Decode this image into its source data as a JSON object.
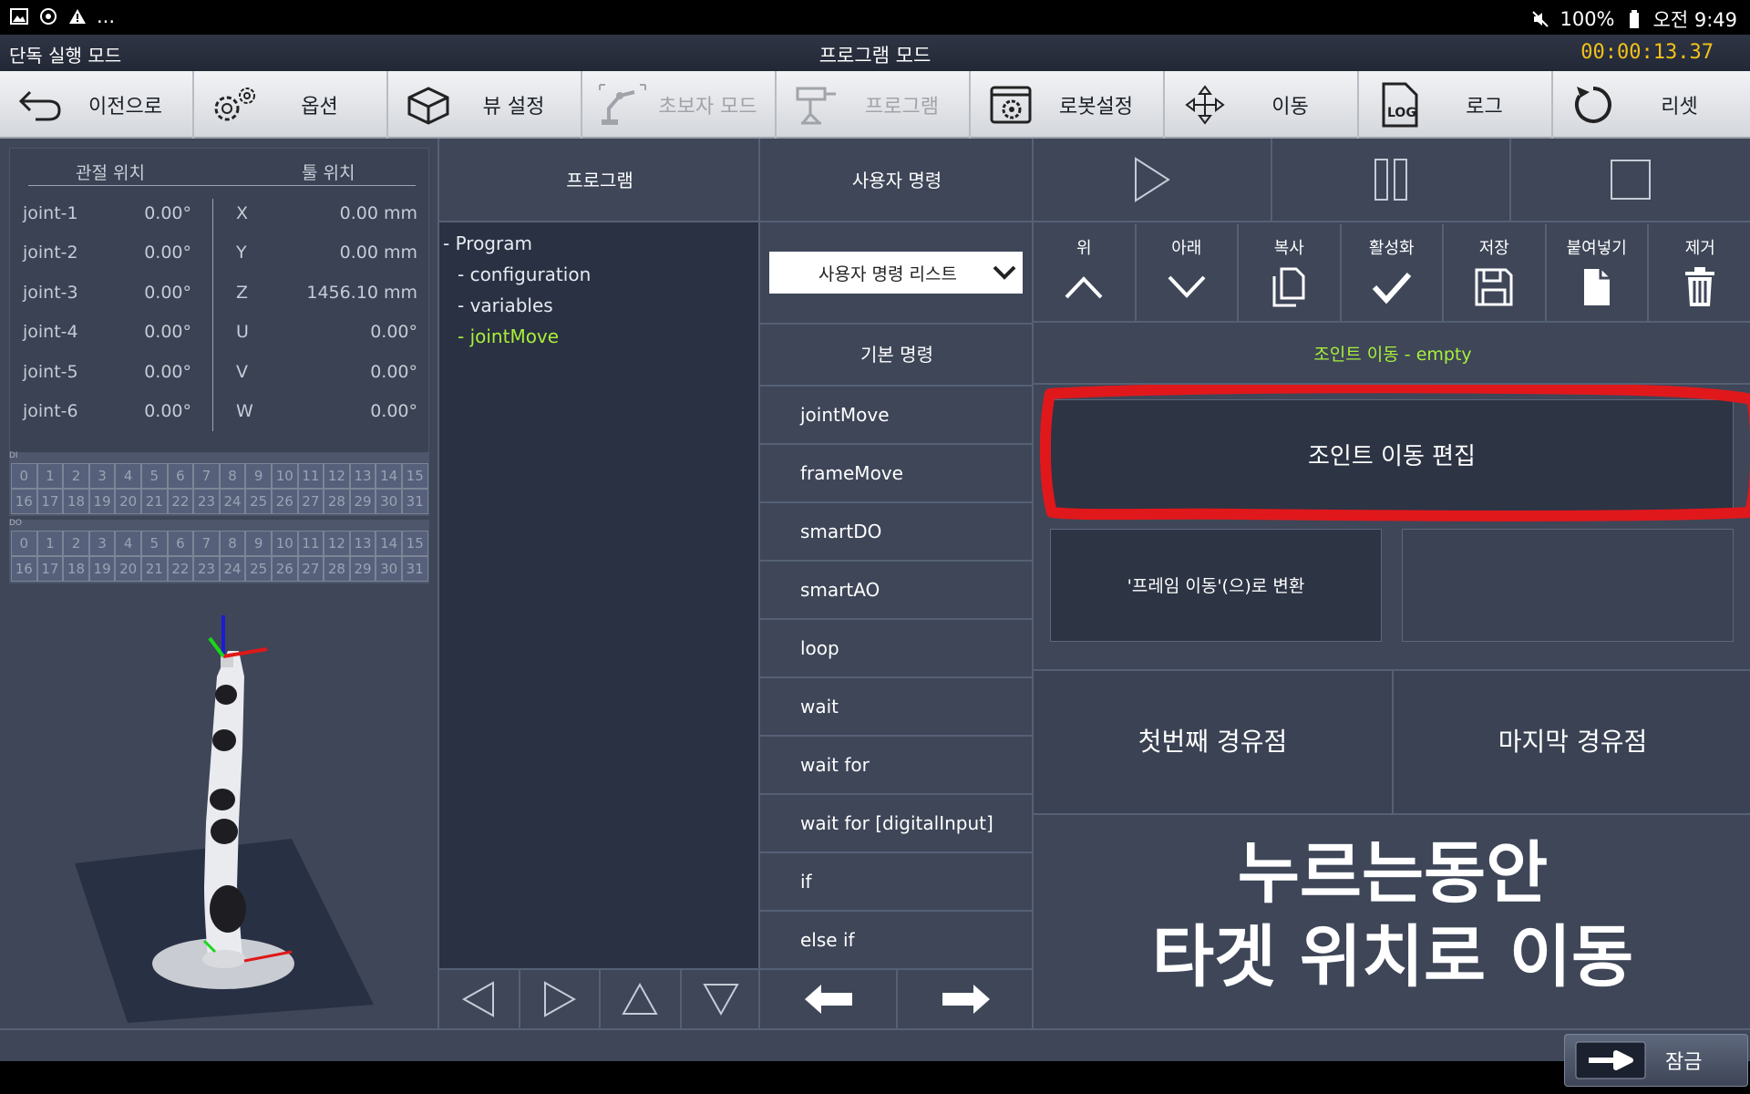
{
  "status_bar": {
    "left_icons": [
      "image-icon",
      "sync-icon",
      "warning-icon"
    ],
    "left_more": "...",
    "battery": "100%",
    "time": "오전 9:49"
  },
  "mode_bar": {
    "left": "단독 실행 모드",
    "center": "프로그램 모드",
    "timer": "00:00:13.37"
  },
  "toolbar": {
    "back": "이전으로",
    "options": "옵션",
    "view": "뷰 설정",
    "beginner": "초보자 모드",
    "program": "프로그램",
    "robot_settings": "로봇설정",
    "move": "이동",
    "log": "로그",
    "reset": "리셋"
  },
  "position": {
    "joint_header": "관절 위치",
    "tool_header": "툴 위치",
    "rows": [
      {
        "joint": "joint-1",
        "jval": "0.00°",
        "axis": "X",
        "tval": "0.00 mm"
      },
      {
        "joint": "joint-2",
        "jval": "0.00°",
        "axis": "Y",
        "tval": "0.00 mm"
      },
      {
        "joint": "joint-3",
        "jval": "0.00°",
        "axis": "Z",
        "tval": "1456.10 mm"
      },
      {
        "joint": "joint-4",
        "jval": "0.00°",
        "axis": "U",
        "tval": "0.00°"
      },
      {
        "joint": "joint-5",
        "jval": "0.00°",
        "axis": "V",
        "tval": "0.00°"
      },
      {
        "joint": "joint-6",
        "jval": "0.00°",
        "axis": "W",
        "tval": "0.00°"
      }
    ]
  },
  "io": {
    "di_label": "DI",
    "do_label": "DO",
    "numbers": [
      "0",
      "1",
      "2",
      "3",
      "4",
      "5",
      "6",
      "7",
      "8",
      "9",
      "10",
      "11",
      "12",
      "13",
      "14",
      "15",
      "16",
      "17",
      "18",
      "19",
      "20",
      "21",
      "22",
      "23",
      "24",
      "25",
      "26",
      "27",
      "28",
      "29",
      "30",
      "31"
    ]
  },
  "program": {
    "header": "프로그램",
    "tree": [
      "- Program",
      "- configuration",
      "- variables",
      "- jointMove"
    ]
  },
  "commands": {
    "header": "사용자 명령",
    "select_value": "사용자 명령 리스트",
    "basic_header": "기본 명령",
    "items": [
      "jointMove",
      "frameMove",
      "smartDO",
      "smartAO",
      "loop",
      "wait",
      "wait for",
      "wait for [digitalInput]",
      "if",
      "else if"
    ]
  },
  "edit": {
    "up": "위",
    "down": "아래",
    "copy": "복사",
    "activate": "활성화",
    "save": "저장",
    "paste": "붙여넣기",
    "remove": "제거"
  },
  "detail": {
    "selected": "조인트 이동 - empty",
    "edit_button": "조인트 이동 편집",
    "convert_button": "'프레임 이동'(으)로 변환",
    "first_waypoint": "첫번째 경유점",
    "last_waypoint": "마지막 경유점",
    "hold_line1": "누르는동안",
    "hold_line2": "타겟 위치로 이동"
  },
  "lock": {
    "label": "잠금"
  },
  "colors": {
    "accent_green": "#a8f03a",
    "timer_yellow": "#f4c11a",
    "highlight_red": "#e0181c"
  }
}
